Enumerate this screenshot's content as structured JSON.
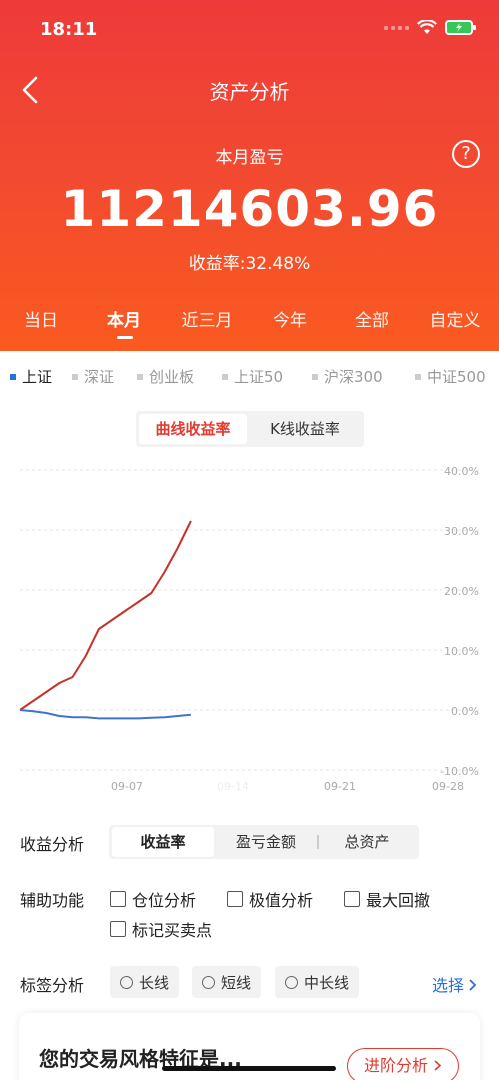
{
  "status_bar": {
    "time": "18:11"
  },
  "header": {
    "title": "资产分析",
    "subtitle": "本月盈亏",
    "amount": "11214603.96",
    "rate_label": "收益率:32.48%",
    "help": "?"
  },
  "period_tabs": [
    {
      "label": "当日"
    },
    {
      "label": "本月"
    },
    {
      "label": "近三月"
    },
    {
      "label": "今年"
    },
    {
      "label": "全部"
    },
    {
      "label": "自定义"
    }
  ],
  "active_period": "本月",
  "index_tabs": [
    {
      "label": "上证"
    },
    {
      "label": "深证"
    },
    {
      "label": "创业板"
    },
    {
      "label": "上证50"
    },
    {
      "label": "沪深300"
    },
    {
      "label": "中证500"
    }
  ],
  "active_index": "上证",
  "chart_mode": {
    "active": "曲线收益率",
    "inactive": "K线收益率"
  },
  "chart_data": {
    "type": "line",
    "y_tick_labels": [
      "40.0%",
      "30.0%",
      "20.0%",
      "10.0%",
      "0.0%",
      "-10.0%"
    ],
    "y_ticks": [
      40,
      30,
      20,
      10,
      0,
      -10
    ],
    "ylim": [
      -10,
      40
    ],
    "x_tick_labels": [
      "09-07",
      "09-14",
      "09-21",
      "09-28"
    ],
    "grid": true,
    "series": [
      {
        "color": "#c8302c",
        "x": [
          0,
          1,
          2,
          3,
          4,
          5,
          6,
          7,
          8,
          9,
          10,
          11,
          12,
          13
        ],
        "values": [
          0,
          1.5,
          3,
          4.5,
          5.5,
          9,
          13.5,
          15,
          16.5,
          18,
          19.5,
          23,
          27,
          31.5
        ]
      },
      {
        "color": "#3d74d4",
        "x": [
          0,
          1,
          2,
          3,
          4,
          5,
          6,
          7,
          8,
          9,
          10,
          11,
          12,
          13
        ],
        "values": [
          0,
          -0.2,
          -0.5,
          -1,
          -1.2,
          -1.2,
          -1.4,
          -1.4,
          -1.4,
          -1.4,
          -1.3,
          -1.2,
          -1.0,
          -0.8
        ]
      }
    ]
  },
  "income_analysis": {
    "label": "收益分析",
    "options": [
      "收益率",
      "盈亏金额",
      "总资产"
    ],
    "active": "收益率"
  },
  "aux": {
    "label": "辅助功能",
    "checkboxes": [
      "仓位分析",
      "极值分析",
      "最大回撤",
      "标记买卖点"
    ]
  },
  "tag_analysis": {
    "label": "标签分析",
    "chips": [
      "长线",
      "短线",
      "中长线"
    ],
    "select": "选择"
  },
  "style_card": {
    "title": "您的交易风格特征是...",
    "button": "进阶分析"
  },
  "colors": {
    "brand_red": "#e63a2e",
    "header_start": "#ee3a3a",
    "header_end": "#fa5a20",
    "link_blue": "#2d6fd8"
  }
}
